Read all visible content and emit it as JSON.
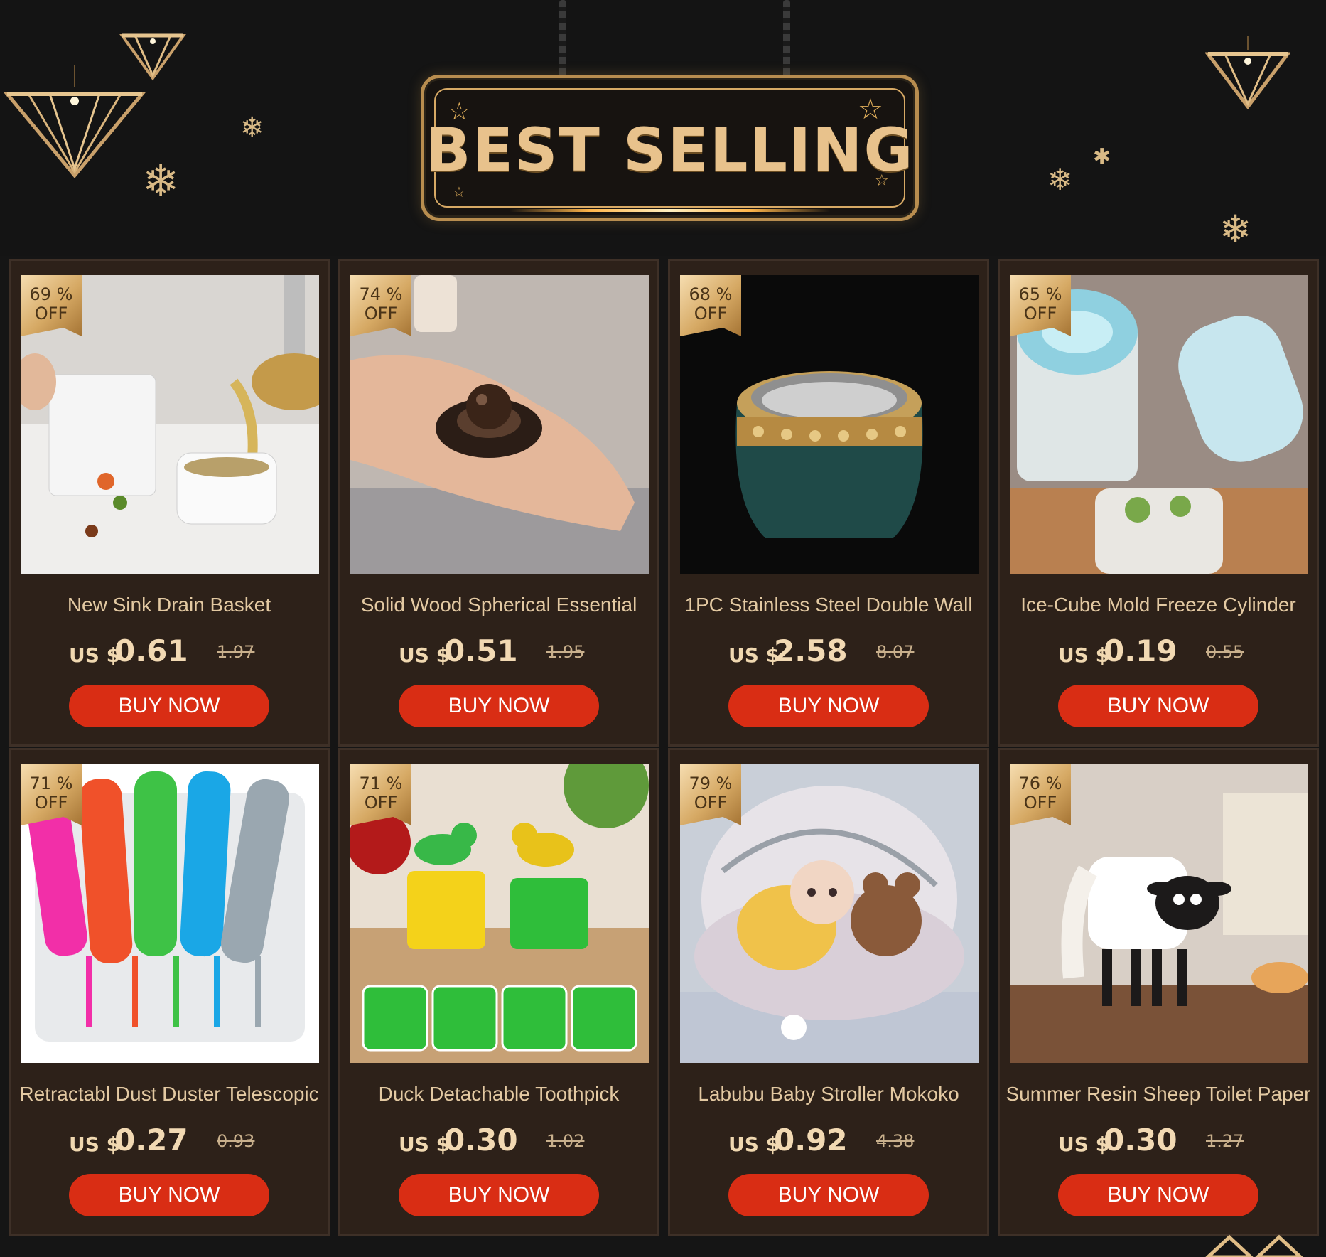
{
  "header": {
    "title": "BEST SELLING"
  },
  "currency_prefix": "US $",
  "colors": {
    "accent_gold": "#d6a964",
    "buy_button": "#d92d14",
    "card_bg": "#2d2119",
    "page_bg": "#151515"
  },
  "products": [
    {
      "discount_pct": "69 %",
      "off": "OFF",
      "title": "New Sink Drain Basket",
      "price": "0.61",
      "old_price": "1.97",
      "buy_label": "BUY NOW"
    },
    {
      "discount_pct": "74 %",
      "off": "OFF",
      "title": "Solid Wood Spherical Essential",
      "price": "0.51",
      "old_price": "1.95",
      "buy_label": "BUY NOW"
    },
    {
      "discount_pct": "68 %",
      "off": "OFF",
      "title": "1PC Stainless Steel Double Wall",
      "price": "2.58",
      "old_price": "8.07",
      "buy_label": "BUY NOW"
    },
    {
      "discount_pct": "65 %",
      "off": "OFF",
      "title": "Ice-Cube Mold Freeze Cylinder",
      "price": "0.19",
      "old_price": "0.55",
      "buy_label": "BUY NOW"
    },
    {
      "discount_pct": "71 %",
      "off": "OFF",
      "title": "Retractabl Dust Duster Telescopic",
      "price": "0.27",
      "old_price": "0.93",
      "buy_label": "BUY NOW"
    },
    {
      "discount_pct": "71 %",
      "off": "OFF",
      "title": "Duck Detachable Toothpick",
      "price": "0.30",
      "old_price": "1.02",
      "buy_label": "BUY NOW"
    },
    {
      "discount_pct": "79 %",
      "off": "OFF",
      "title": "Labubu Baby Stroller Mokoko",
      "price": "0.92",
      "old_price": "4.38",
      "buy_label": "BUY NOW"
    },
    {
      "discount_pct": "76 %",
      "off": "OFF",
      "title": "Summer Resin Sheep Toilet Paper",
      "price": "0.30",
      "old_price": "1.27",
      "buy_label": "BUY NOW"
    }
  ]
}
